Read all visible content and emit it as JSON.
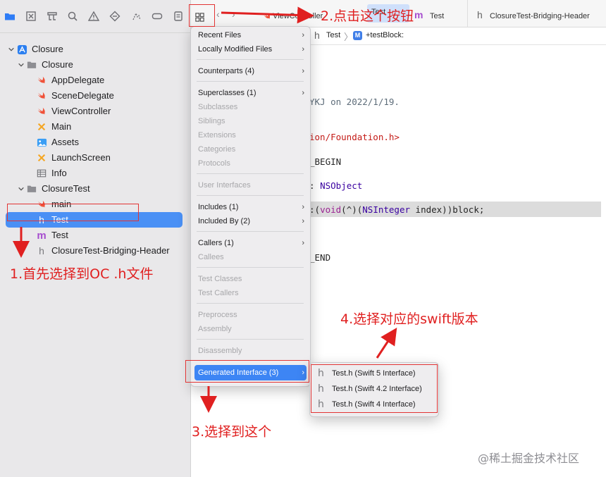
{
  "colors": {
    "accent": "#4a90f5",
    "menu_highlight": "#3d85f4",
    "annotation_red": "#e02020",
    "swift_orange": "#f05138"
  },
  "navigator": {
    "toolbar_icons": [
      "folder-icon",
      "x-square-icon",
      "hierarchy-icon",
      "search-icon",
      "warning-icon",
      "diamond-icon",
      "test-icon",
      "label-icon",
      "report-icon"
    ],
    "tree": [
      {
        "label": "Closure",
        "icon": "xcode-project-icon",
        "expanded": true
      },
      {
        "label": "Closure",
        "icon": "folder-icon",
        "expanded": true
      },
      {
        "label": "AppDelegate",
        "icon": "swift-file-icon"
      },
      {
        "label": "SceneDelegate",
        "icon": "swift-file-icon"
      },
      {
        "label": "ViewController",
        "icon": "swift-file-icon"
      },
      {
        "label": "Main",
        "icon": "storyboard-icon"
      },
      {
        "label": "Assets",
        "icon": "assets-icon"
      },
      {
        "label": "LaunchScreen",
        "icon": "storyboard-icon"
      },
      {
        "label": "Info",
        "icon": "plist-icon"
      },
      {
        "label": "ClosureTest",
        "icon": "folder-icon",
        "expanded": true
      },
      {
        "label": "main",
        "icon": "swift-file-icon"
      },
      {
        "label": "Test",
        "icon": "header-file-icon",
        "selected": true
      },
      {
        "label": "Test",
        "icon": "objc-m-file-icon"
      },
      {
        "label": "ClosureTest-Bridging-Header",
        "icon": "header-file-icon"
      }
    ]
  },
  "tabs": [
    {
      "label": "ViewController",
      "icon": "swift-file-icon"
    },
    {
      "label": "Test",
      "icon": "header-file-icon",
      "active": true
    },
    {
      "label": "Test",
      "icon": "objc-m-file-icon"
    },
    {
      "label": "ClosureTest-Bridging-Header",
      "icon": "header-file-icon"
    }
  ],
  "jump_bar": {
    "file": "Test",
    "symbol_badge": "M",
    "symbol": "+testBlock:"
  },
  "code": {
    "comment_line": "YKJ on 2022/1/19.",
    "import_line": "ion/Foundation.h>",
    "begin_line": "_BEGIN",
    "interface_colon": ": ",
    "interface_super": "NSObject",
    "method_pre": ":(",
    "method_void": "void",
    "method_mid": "(^)(",
    "method_type": "NSInteger",
    "method_post": " index))block;",
    "end_line": "_END"
  },
  "related_menu": {
    "items": [
      {
        "label": "Recent Files",
        "chevron": true
      },
      {
        "label": "Locally Modified Files",
        "chevron": true
      },
      {
        "label": "Counterparts (4)",
        "chevron": true
      },
      {
        "label": "Superclasses (1)",
        "chevron": true
      },
      {
        "label": "Subclasses",
        "disabled": true
      },
      {
        "label": "Siblings",
        "disabled": true
      },
      {
        "label": "Extensions",
        "disabled": true
      },
      {
        "label": "Categories",
        "disabled": true
      },
      {
        "label": "Protocols",
        "disabled": true
      },
      {
        "label": "User Interfaces",
        "disabled": true
      },
      {
        "label": "Includes (1)",
        "chevron": true
      },
      {
        "label": "Included By (2)",
        "chevron": true
      },
      {
        "label": "Callers (1)",
        "chevron": true
      },
      {
        "label": "Callees",
        "disabled": true
      },
      {
        "label": "Test Classes",
        "disabled": true
      },
      {
        "label": "Test Callers",
        "disabled": true
      },
      {
        "label": "Preprocess",
        "disabled": true
      },
      {
        "label": "Assembly",
        "disabled": true
      },
      {
        "label": "Disassembly",
        "disabled": true
      },
      {
        "label": "Generated Interface (3)",
        "chevron": true,
        "highlighted": true
      }
    ],
    "chevron_glyph": "›"
  },
  "generated_interface_submenu": [
    {
      "label": "Test.h (Swift 5 Interface)",
      "icon": "h"
    },
    {
      "label": "Test.h (Swift 4.2 Interface)",
      "icon": "h"
    },
    {
      "label": "Test.h (Swift 4 Interface)",
      "icon": "h"
    }
  ],
  "annotations": {
    "step1": "1.首先选择到OC  .h文件",
    "step2": "2.点击这个按钮",
    "step3": "3.选择到这个",
    "step4": "4.选择对应的swift版本"
  },
  "watermark": "@稀土掘金技术社区"
}
